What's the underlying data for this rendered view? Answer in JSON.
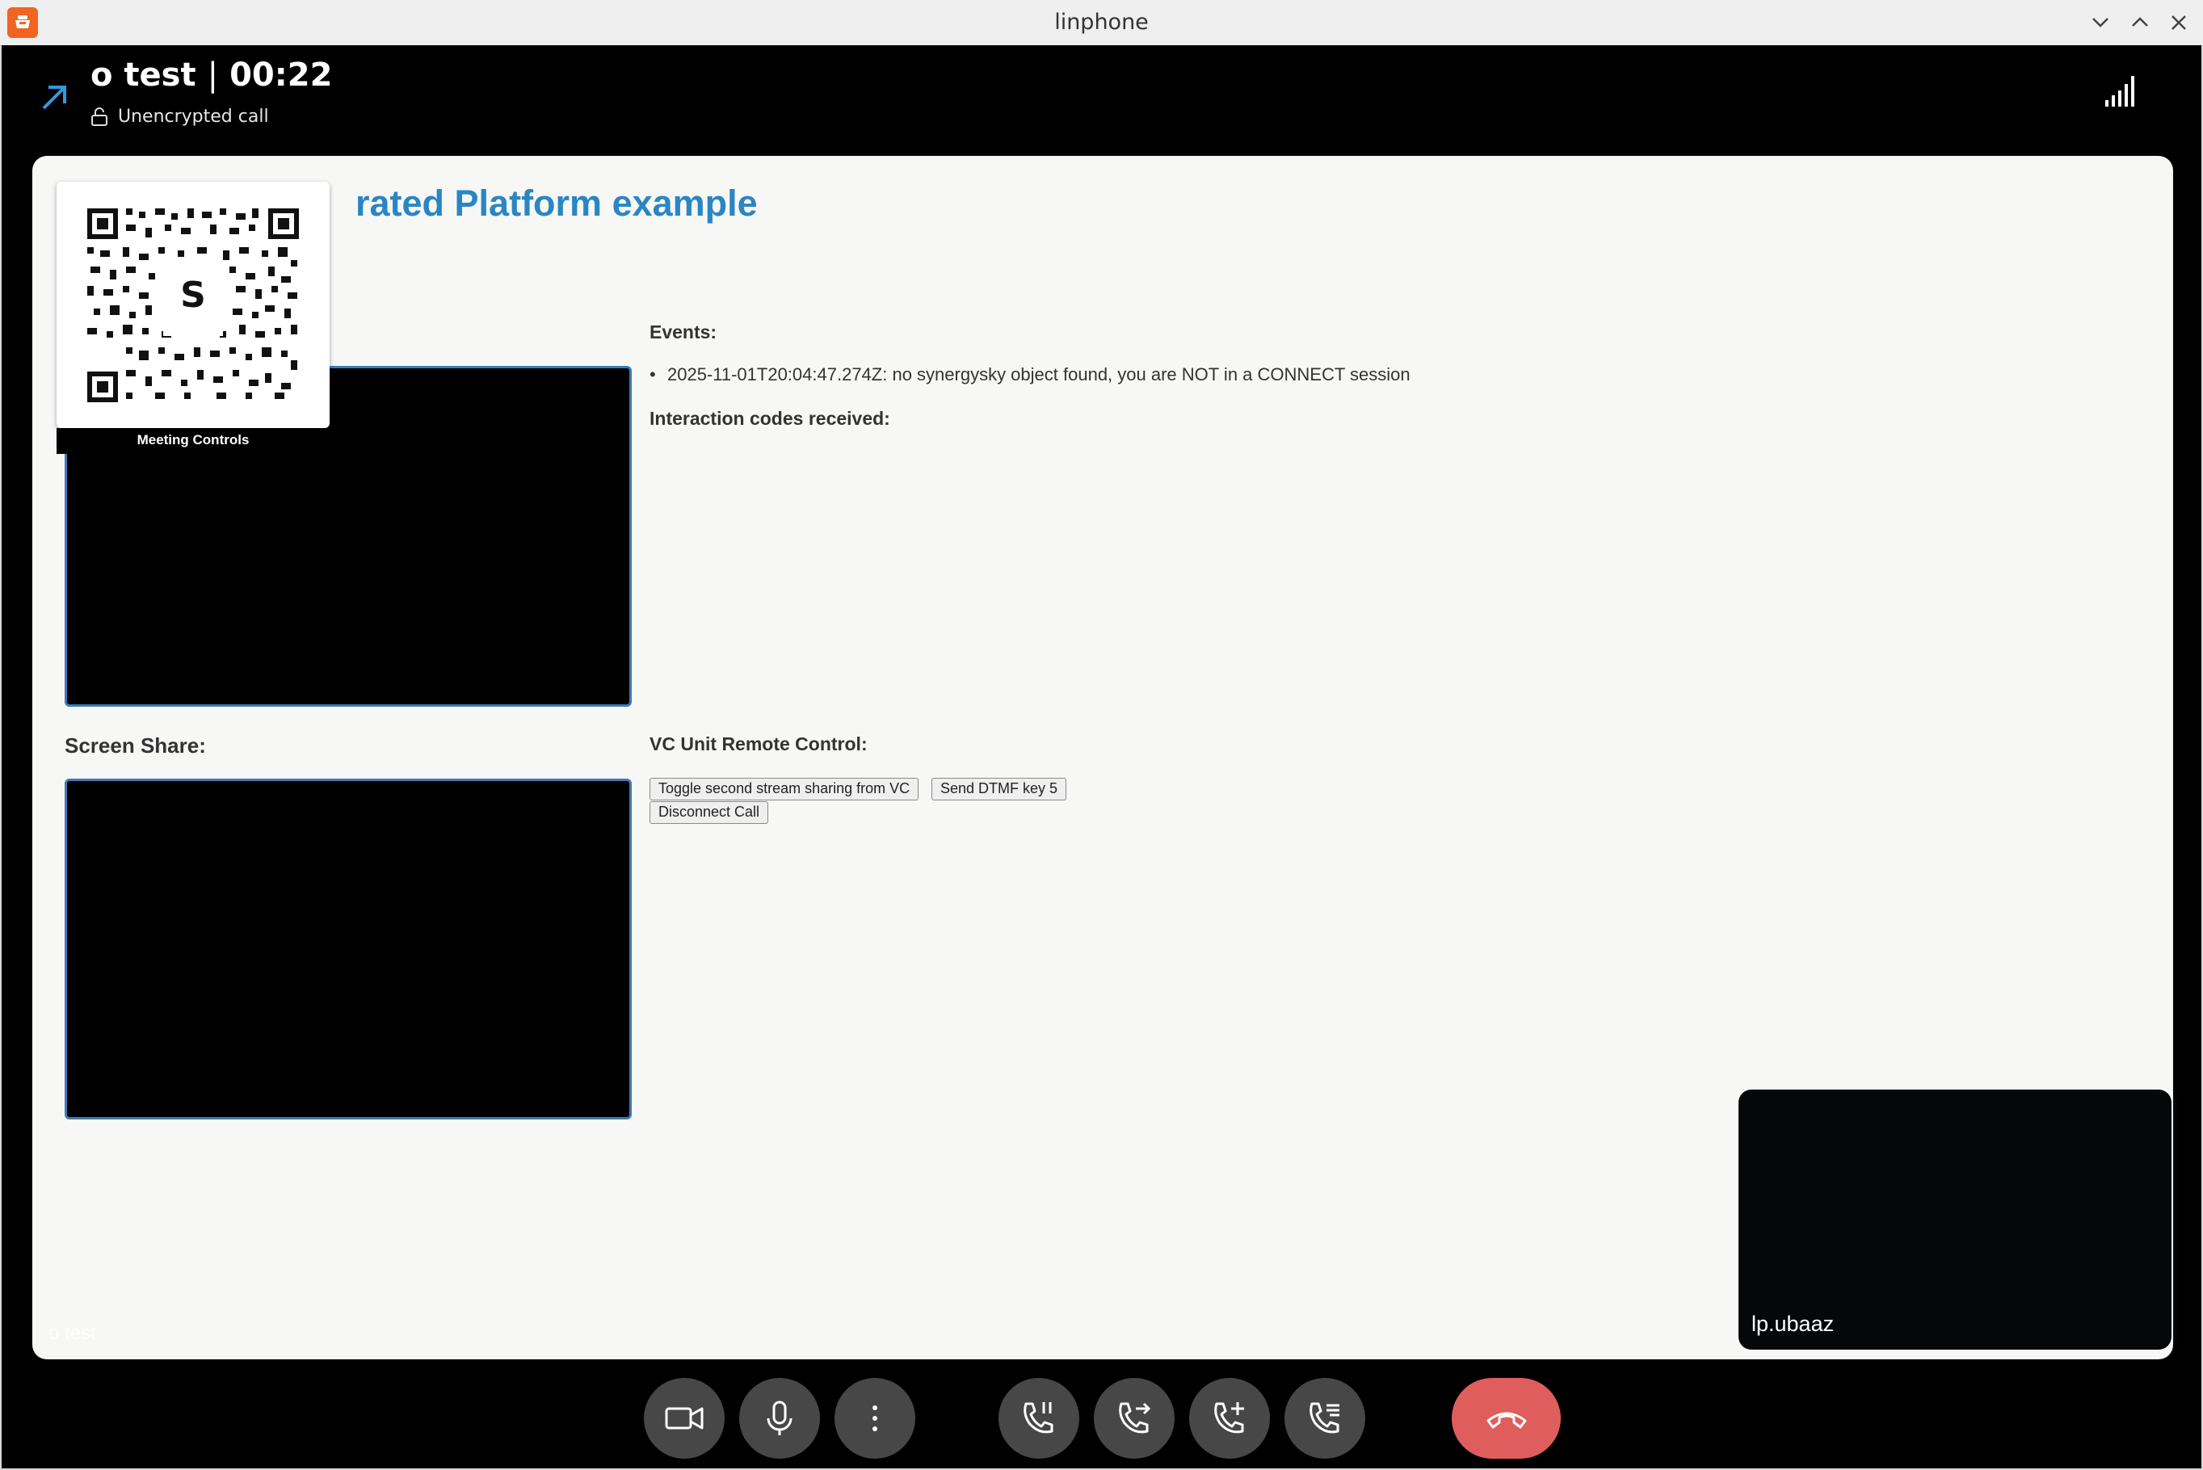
{
  "window": {
    "title": "linphone",
    "icons": [
      "linphone-logo-icon",
      "minimize-icon",
      "maximize-icon",
      "close-icon"
    ]
  },
  "call": {
    "contact": "o test",
    "separator": "|",
    "duration": "00:22",
    "encryption_status": "Unencrypted call",
    "direction": "outgoing",
    "remote_name_overlay": "o test",
    "local_name": "lp.ubaaz"
  },
  "remote_page": {
    "heading": "rated Platform example",
    "qr_caption": "Meeting Controls",
    "qr_logo_text": "SYNERGY SKY",
    "events_label": "Events:",
    "events": [
      "2025-11-01T20:04:47.274Z: no synergysky object found, you are NOT in a CONNECT session"
    ],
    "interaction_label": "Interaction codes received:",
    "screen_share_label": "Screen Share:",
    "vc_label": "VC Unit Remote Control:",
    "buttons": {
      "toggle": "Toggle second stream sharing from VC",
      "dtmf": "Send DTMF key 5",
      "disconnect": "Disconnect Call"
    }
  },
  "controls": {
    "buttons": [
      "camera-icon",
      "microphone-icon",
      "more-options-icon",
      "pause-call-icon",
      "transfer-call-icon",
      "add-call-icon",
      "call-list-icon",
      "hang-up-icon"
    ],
    "hangup_color": "#e05d5d"
  },
  "colors": {
    "accent": "#2a86c3",
    "brand": "#f16522",
    "background": "#000000"
  }
}
